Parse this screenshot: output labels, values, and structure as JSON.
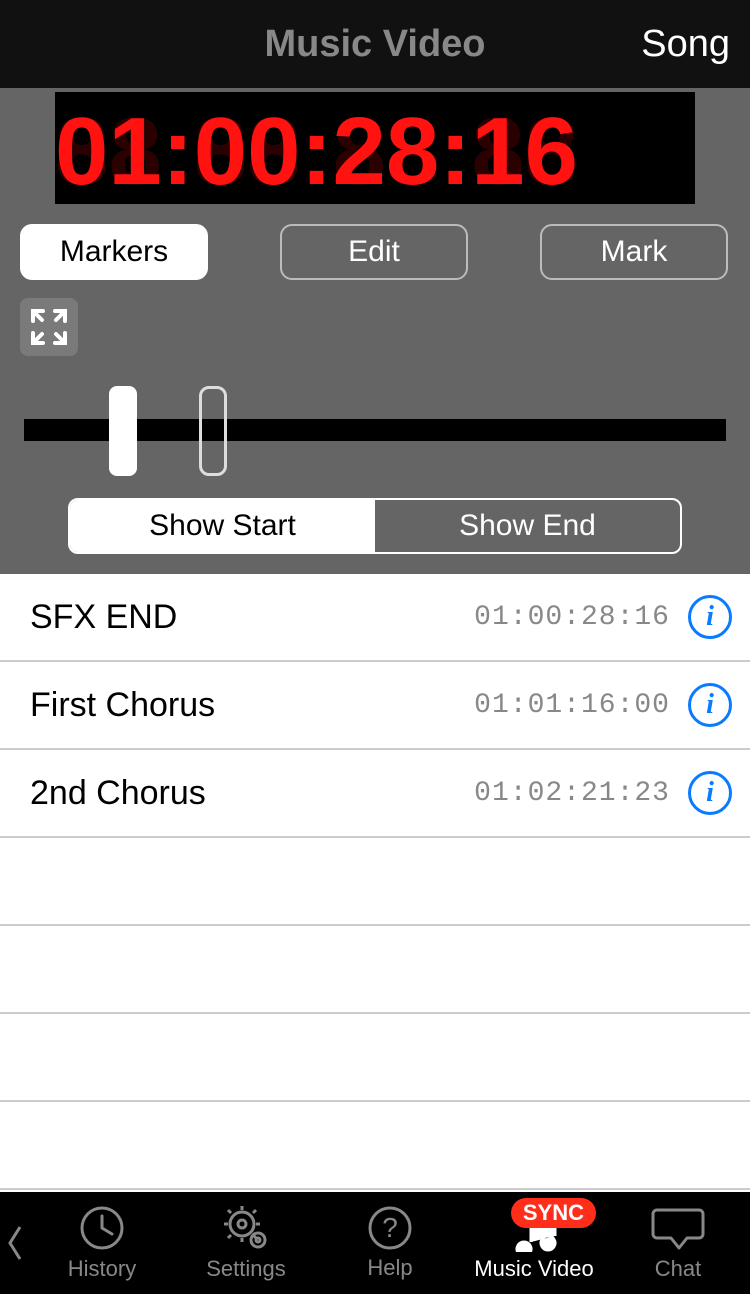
{
  "header": {
    "title": "Music Video",
    "action": "Song"
  },
  "timecode": {
    "value": "01:00:28:16"
  },
  "toolbar": {
    "markers": "Markers",
    "edit": "Edit",
    "mark": "Mark"
  },
  "segmented": {
    "show_start": "Show Start",
    "show_end": "Show End",
    "active": "show_start"
  },
  "markers": [
    {
      "name": "SFX END",
      "time": "01:00:28:16"
    },
    {
      "name": "First Chorus",
      "time": "01:01:16:00"
    },
    {
      "name": "2nd Chorus",
      "time": "01:02:21:23"
    }
  ],
  "tabs": {
    "history": "History",
    "settings": "Settings",
    "help": "Help",
    "music_video": "Music Video",
    "chat": "Chat",
    "sync_badge": "SYNC",
    "active": "music_video"
  }
}
